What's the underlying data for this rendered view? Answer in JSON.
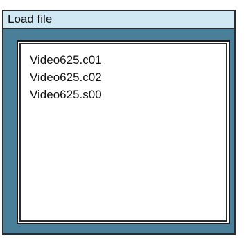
{
  "dialog": {
    "title": "Load file",
    "files": [
      "Video625.c01",
      "Video625.c02",
      "Video625.s00"
    ]
  }
}
